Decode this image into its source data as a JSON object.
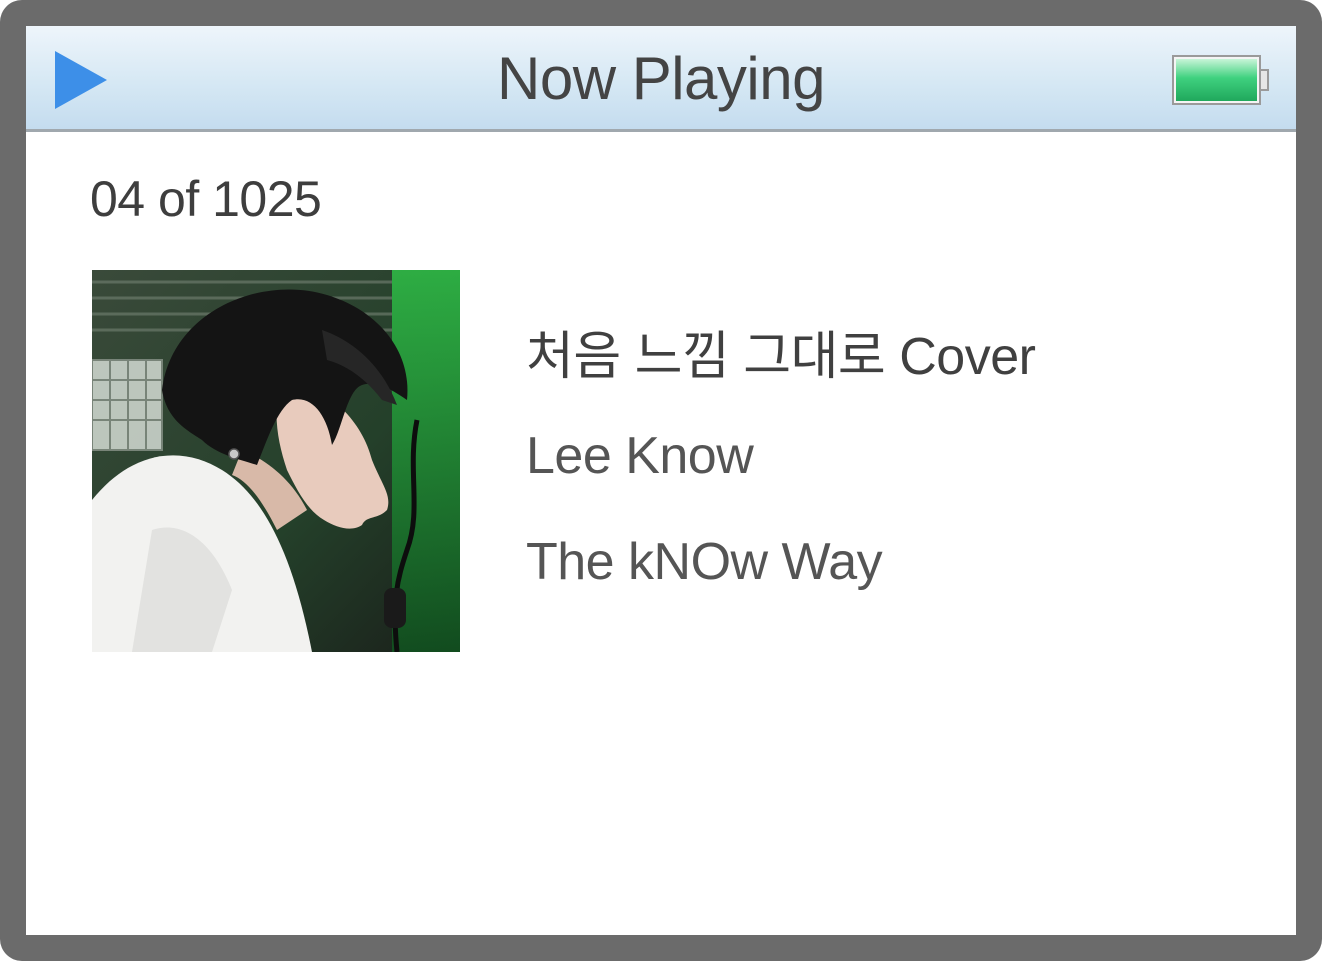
{
  "header": {
    "title": "Now Playing",
    "play_icon": "play-icon",
    "battery_icon": "battery-full-icon",
    "accent_color": "#3d8fe8",
    "battery_color": "#2ecc71"
  },
  "track": {
    "position": "04 of 1025",
    "title": "처음 느낌 그대로 Cover",
    "artist": "Lee Know",
    "album": "The kNOw Way"
  },
  "artwork": {
    "semantic": "album-cover-photo"
  }
}
